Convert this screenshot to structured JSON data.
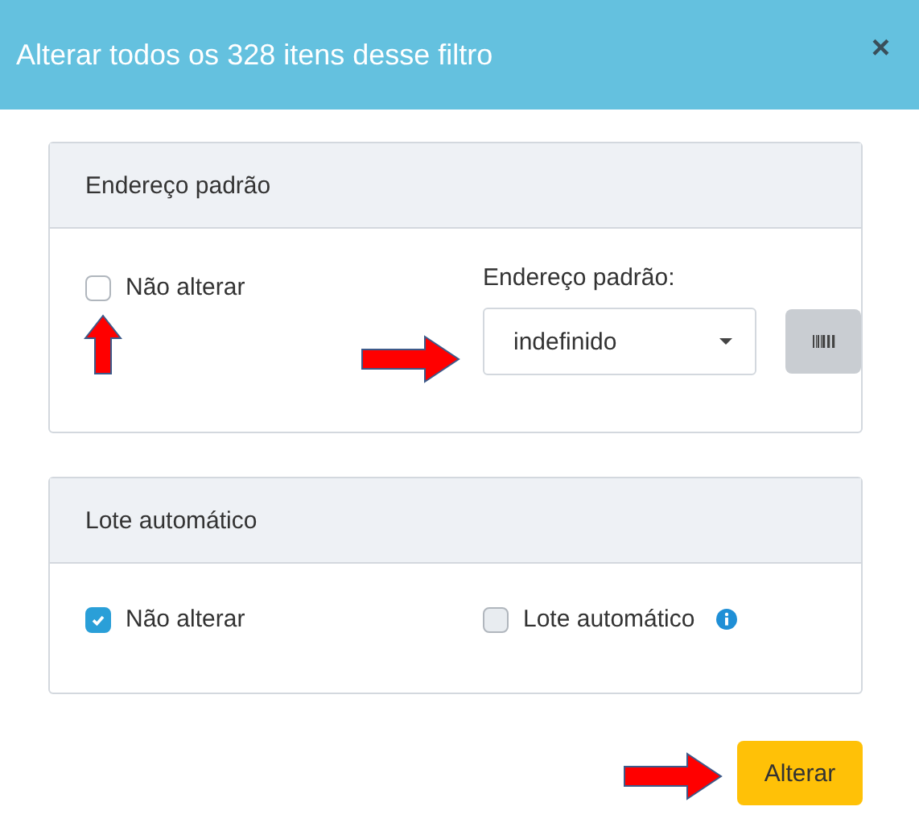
{
  "dialog": {
    "title": "Alterar todos os 328 itens desse filtro",
    "close": "×"
  },
  "sections": [
    {
      "title": "Endereço padrão",
      "keep": {
        "label": "Não alterar",
        "checked": false
      },
      "field": {
        "kind": "select",
        "label": "Endereço padrão:",
        "value": "indefinido"
      }
    },
    {
      "title": "Lote automático",
      "keep": {
        "label": "Não alterar",
        "checked": true
      },
      "field": {
        "kind": "checkbox",
        "label": "Lote automático",
        "checked": false
      }
    }
  ],
  "submit": "Alterar"
}
